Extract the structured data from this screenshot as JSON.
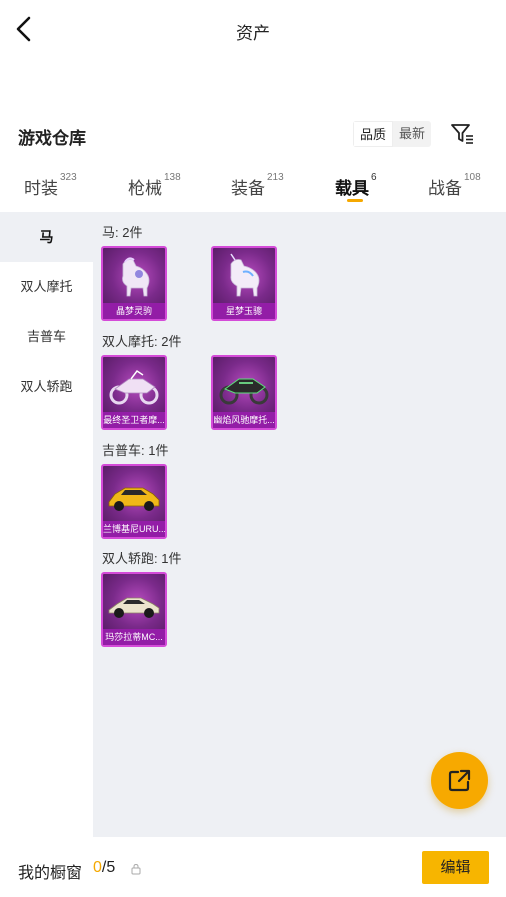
{
  "header": {
    "title": "资产"
  },
  "section": {
    "title": "游戏仓库",
    "sort_options": [
      "品质",
      "最新"
    ],
    "active_sort": 0
  },
  "tabs": [
    {
      "label": "时装",
      "count": "323"
    },
    {
      "label": "枪械",
      "count": "138"
    },
    {
      "label": "装备",
      "count": "213"
    },
    {
      "label": "载具",
      "count": "6",
      "active": true
    },
    {
      "label": "战备",
      "count": "108"
    }
  ],
  "sidebar": {
    "items": [
      "马",
      "双人摩托",
      "吉普车",
      "双人轿跑"
    ],
    "active": 0
  },
  "groups": [
    {
      "title": "马: 2件",
      "items": [
        {
          "name": "晶梦灵驹"
        },
        {
          "name": "星梦玉骢"
        }
      ]
    },
    {
      "title": "双人摩托: 2件",
      "items": [
        {
          "name": "最终圣卫者摩..."
        },
        {
          "name": "幽焰风驰摩托..."
        }
      ]
    },
    {
      "title": "吉普车: 1件",
      "items": [
        {
          "name": "兰博基尼URU..."
        }
      ]
    },
    {
      "title": "双人轿跑: 1件",
      "items": [
        {
          "name": "玛莎拉蒂MC..."
        }
      ]
    }
  ],
  "bottom": {
    "label": "我的橱窗",
    "current": "0",
    "total": "/5",
    "edit_label": "编辑"
  },
  "colors": {
    "accent": "#f5a800",
    "card_border": "#d44bd8",
    "panel_bg": "#eef0f4"
  }
}
